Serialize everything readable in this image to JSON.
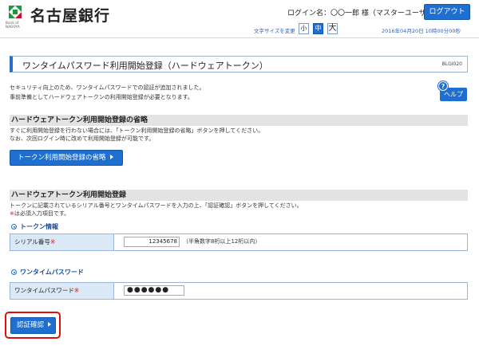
{
  "header": {
    "bank_name": "名古屋銀行",
    "bank_sub": "Bank of NAGOYA",
    "login_name": "ログイン名：〇〇一郎 様（マスターユーザー）",
    "logout_label": "ログアウト",
    "font_size_label": "文字サイズを変更",
    "font_small": "小",
    "font_medium": "中",
    "font_large": "大",
    "datetime": "2016年04月20日  10時00分00秒",
    "accent_color": "#1e6fd0"
  },
  "page": {
    "title": "ワンタイムパスワード利用開始登録（ハードウェアトークン）",
    "screen_id": "BLGI020",
    "intro_lines": [
      "セキュリティ向上のため、ワンタイムパスワードでの認証が追加されました。",
      "事前準備としてハードウェアトークンの利用開始登録が必要となります。"
    ],
    "help_label": "ヘルプ",
    "help_icon": "?"
  },
  "skip_section": {
    "title": "ハードウェアトークン利用開始登録の省略",
    "desc_lines": [
      "すぐに利用開始登録を行わない場合には、「トークン利用開始登録の省略」ボタンを押してください。",
      "なお、次回ログイン時に改めて利用開始登録が可能です。"
    ],
    "button_label": "トークン利用開始登録の省略"
  },
  "register_section": {
    "title": "ハードウェアトークン利用開始登録",
    "desc_line": "トークンに記載されているシリアル番号とワンタイムパスワードを入力の上、「認証確認」ボタンを押してください。",
    "required_mark": "※",
    "required_note": "は必須入力項目です。",
    "token_info_head": "トークン情報",
    "serial_label": "シリアル番号",
    "serial_value": "12345678",
    "serial_hint": "（半角数字8桁以上12桁以内）",
    "otp_head": "ワンタイムパスワード",
    "otp_label": "ワンタイムパスワード",
    "otp_value": "●●●●●●",
    "confirm_label": "認証確認"
  }
}
